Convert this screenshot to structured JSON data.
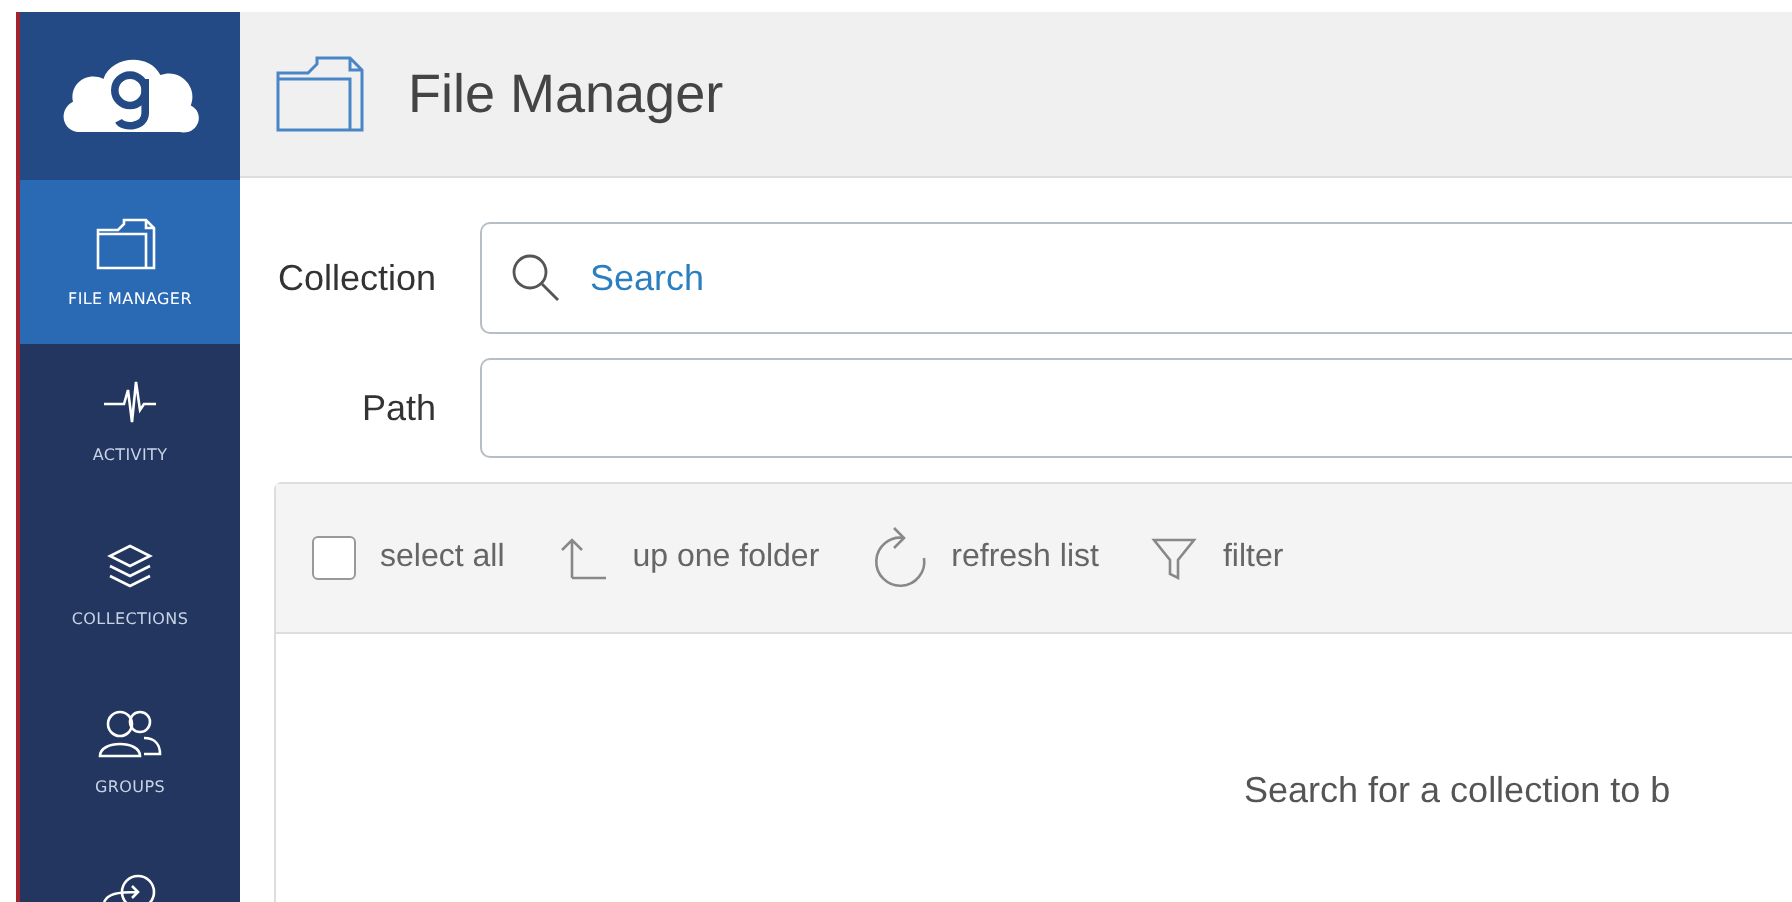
{
  "sidebar": {
    "items": [
      {
        "kind": "files",
        "label": "FILE MANAGER",
        "selected": true
      },
      {
        "kind": "activity",
        "label": "ACTIVITY",
        "selected": false
      },
      {
        "kind": "collections",
        "label": "COLLECTIONS",
        "selected": false
      },
      {
        "kind": "groups",
        "label": "GROUPS",
        "selected": false
      },
      {
        "kind": "console",
        "selected": false
      }
    ]
  },
  "header": {
    "title": "File Manager"
  },
  "form": {
    "collection": {
      "label": "Collection",
      "placeholder": "Search"
    },
    "path": {
      "label": "Path"
    }
  },
  "toolbar": {
    "select_all": {
      "label": "select all",
      "checked": false
    },
    "actions": [
      {
        "kind": "up",
        "label": "up one folder"
      },
      {
        "kind": "refresh",
        "label": "refresh list"
      },
      {
        "kind": "filter",
        "label": "filter"
      }
    ]
  },
  "message": "Search for a collection to b"
}
